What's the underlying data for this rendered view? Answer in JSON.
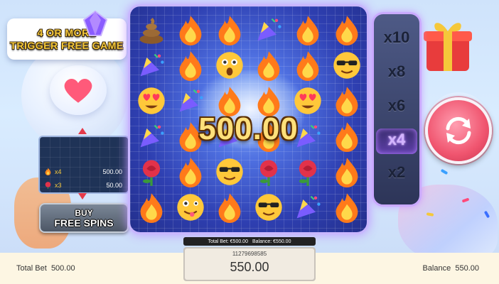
{
  "trigger_banner": {
    "line1": "4 OR MORE",
    "line2": "TRIGGER FREE GAME"
  },
  "paytable": {
    "rows": [
      {
        "icon": "fire-icon",
        "count": "x4",
        "value": "500.00"
      },
      {
        "icon": "rose-icon",
        "count": "x3",
        "value": "50.00"
      }
    ]
  },
  "buy_button": {
    "line1": "BUY",
    "line2": "FREE SPINS"
  },
  "win_amount": "500.00",
  "multipliers": {
    "items": [
      "x10",
      "x8",
      "x6",
      "x4",
      "x2"
    ],
    "active": "x4"
  },
  "info_strip": {
    "total_bet": "Total Bet: €500.00",
    "balance": "Balance: €550.00"
  },
  "round_id": "11279698585",
  "balance_display": "550.00",
  "footer": {
    "total_bet_label": "Total Bet",
    "total_bet_value": "500.00",
    "balance_label": "Balance",
    "balance_value": "550.00"
  },
  "grid": [
    [
      "poop",
      "fire",
      "fire",
      "party-horn",
      "fire",
      "fire"
    ],
    [
      "party-horn",
      "fire",
      "surprised",
      "fire",
      "fire",
      "sunglasses"
    ],
    [
      "heart-eyes",
      "party-horn",
      "fire",
      "fire",
      "heart-eyes",
      "fire"
    ],
    [
      "party-horn",
      "fire",
      "party-horn",
      "fire",
      "party-horn",
      "fire"
    ],
    [
      "rose",
      "fire",
      "sunglasses",
      "rose",
      "rose",
      "fire"
    ],
    [
      "fire",
      "silly",
      "fire",
      "sunglasses",
      "party-horn",
      "fire"
    ]
  ],
  "colors": {
    "accent": "#c9a9ff",
    "win_text": "#ffe07a",
    "spin": "#f0556f",
    "banner_text": "#f5c83a"
  }
}
